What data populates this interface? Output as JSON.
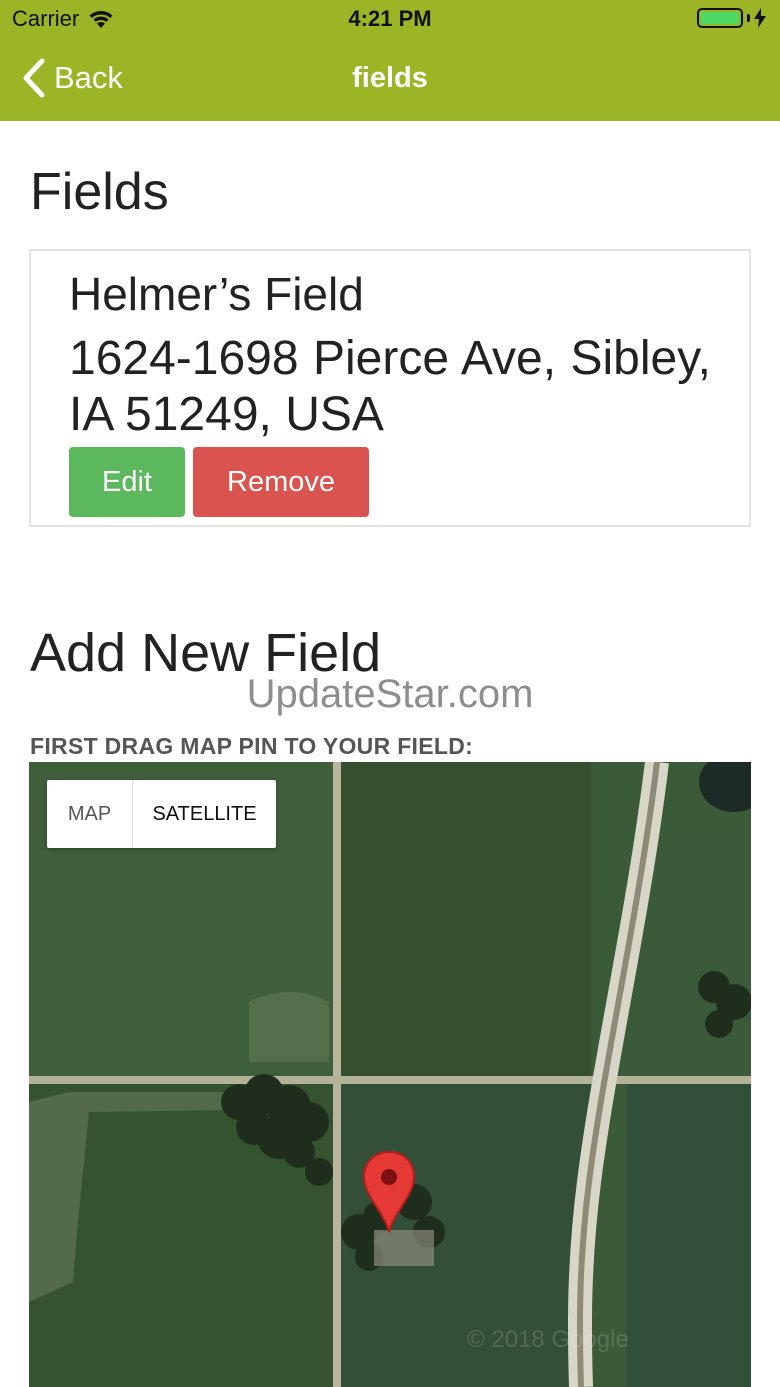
{
  "status_bar": {
    "carrier": "Carrier",
    "time": "4:21 PM",
    "battery_level": 1.0
  },
  "nav": {
    "back_label": "Back",
    "title": "fields"
  },
  "fields_section": {
    "heading": "Fields",
    "items": [
      {
        "name": "Helmer’s Field",
        "address": "1624-1698 Pierce Ave, Sibley, IA 51249, USA",
        "edit_label": "Edit",
        "remove_label": "Remove"
      }
    ]
  },
  "add_section": {
    "heading": "Add New Field",
    "watermark": "UpdateStar.com",
    "instruction": "FIRST DRAG MAP PIN TO YOUR FIELD:"
  },
  "map": {
    "type_options": [
      "MAP",
      "SATELLITE"
    ],
    "selected_type": "SATELLITE",
    "copyright": "© 2018 Google"
  },
  "colors": {
    "header_green": "#9bb526",
    "edit_green": "#5cb85c",
    "remove_red": "#d9534f",
    "pin_red": "#e53935"
  },
  "icons": {
    "back": "chevron-left-icon",
    "wifi": "wifi-icon",
    "battery": "battery-icon",
    "charging": "bolt-icon",
    "pin": "map-pin-icon"
  }
}
